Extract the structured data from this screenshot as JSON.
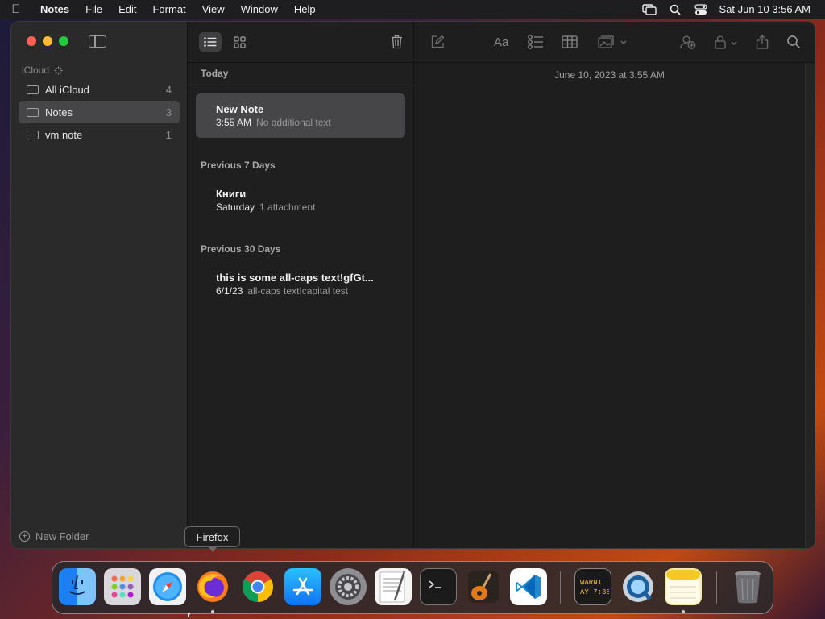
{
  "menubar": {
    "apple_icon": "apple-logo-icon",
    "app_name": "Notes",
    "items": [
      "File",
      "Edit",
      "Format",
      "View",
      "Window",
      "Help"
    ],
    "clock": "Sat Jun 10  3:56 AM",
    "status_icons": [
      "screen-mirroring-icon",
      "spotlight-search-icon",
      "control-center-icon"
    ]
  },
  "sidebar": {
    "section_label": "iCloud",
    "folders": [
      {
        "name": "All iCloud",
        "count": "4"
      },
      {
        "name": "Notes",
        "count": "3"
      },
      {
        "name": "vm note",
        "count": "1"
      }
    ],
    "new_folder_label": "New Folder"
  },
  "list": {
    "groups": [
      {
        "header": "Today"
      },
      {
        "header": "Previous 7 Days"
      },
      {
        "header": "Previous 30 Days"
      }
    ],
    "notes": [
      {
        "title": "New Note",
        "date": "3:55 AM",
        "preview": "No additional text"
      },
      {
        "title": "Книги",
        "date": "Saturday",
        "preview": "1 attachment"
      },
      {
        "title": "this is some all-caps text!gfGt...",
        "date": "6/1/23",
        "preview": "all-caps text!capital test"
      }
    ]
  },
  "detail": {
    "note_date": "June 10, 2023 at 3:55 AM",
    "format_label": "Aa",
    "toolbar_icons": [
      "compose-icon",
      "format-text-icon",
      "checklist-icon",
      "table-icon",
      "media-icon",
      "collaborate-icon",
      "lock-icon",
      "share-icon",
      "search-icon"
    ]
  },
  "tooltip": {
    "text": "Firefox"
  },
  "dock": {
    "apps": [
      "Finder",
      "Launchpad",
      "Safari",
      "Firefox",
      "Chrome",
      "App Store",
      "System Settings",
      "TextEdit",
      "Terminal",
      "GarageBand",
      "VS Code",
      "Console",
      "QuickTime Player",
      "Notes",
      "Trash"
    ],
    "console_text": "WARNI\nAY 7:36"
  }
}
